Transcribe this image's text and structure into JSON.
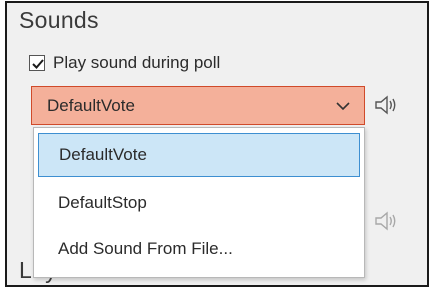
{
  "sounds_section": {
    "title": "Sounds",
    "play_sound_label": "Play sound during poll",
    "play_sound_checked": true,
    "selected_sound": "DefaultVote",
    "options": [
      "DefaultVote",
      "DefaultStop",
      "Add Sound From File..."
    ],
    "highlighted_option_index": 0
  },
  "layout_section": {
    "title": "Layout"
  },
  "icons": {
    "checkbox": "checkmark-icon",
    "dropdown": "chevron-down-icon",
    "preview": "speaker-icon"
  },
  "colors": {
    "select_background": "#f4b09a",
    "select_border": "#d04a2a",
    "highlight_background": "#cce6f7",
    "highlight_border": "#3d8fd1"
  }
}
